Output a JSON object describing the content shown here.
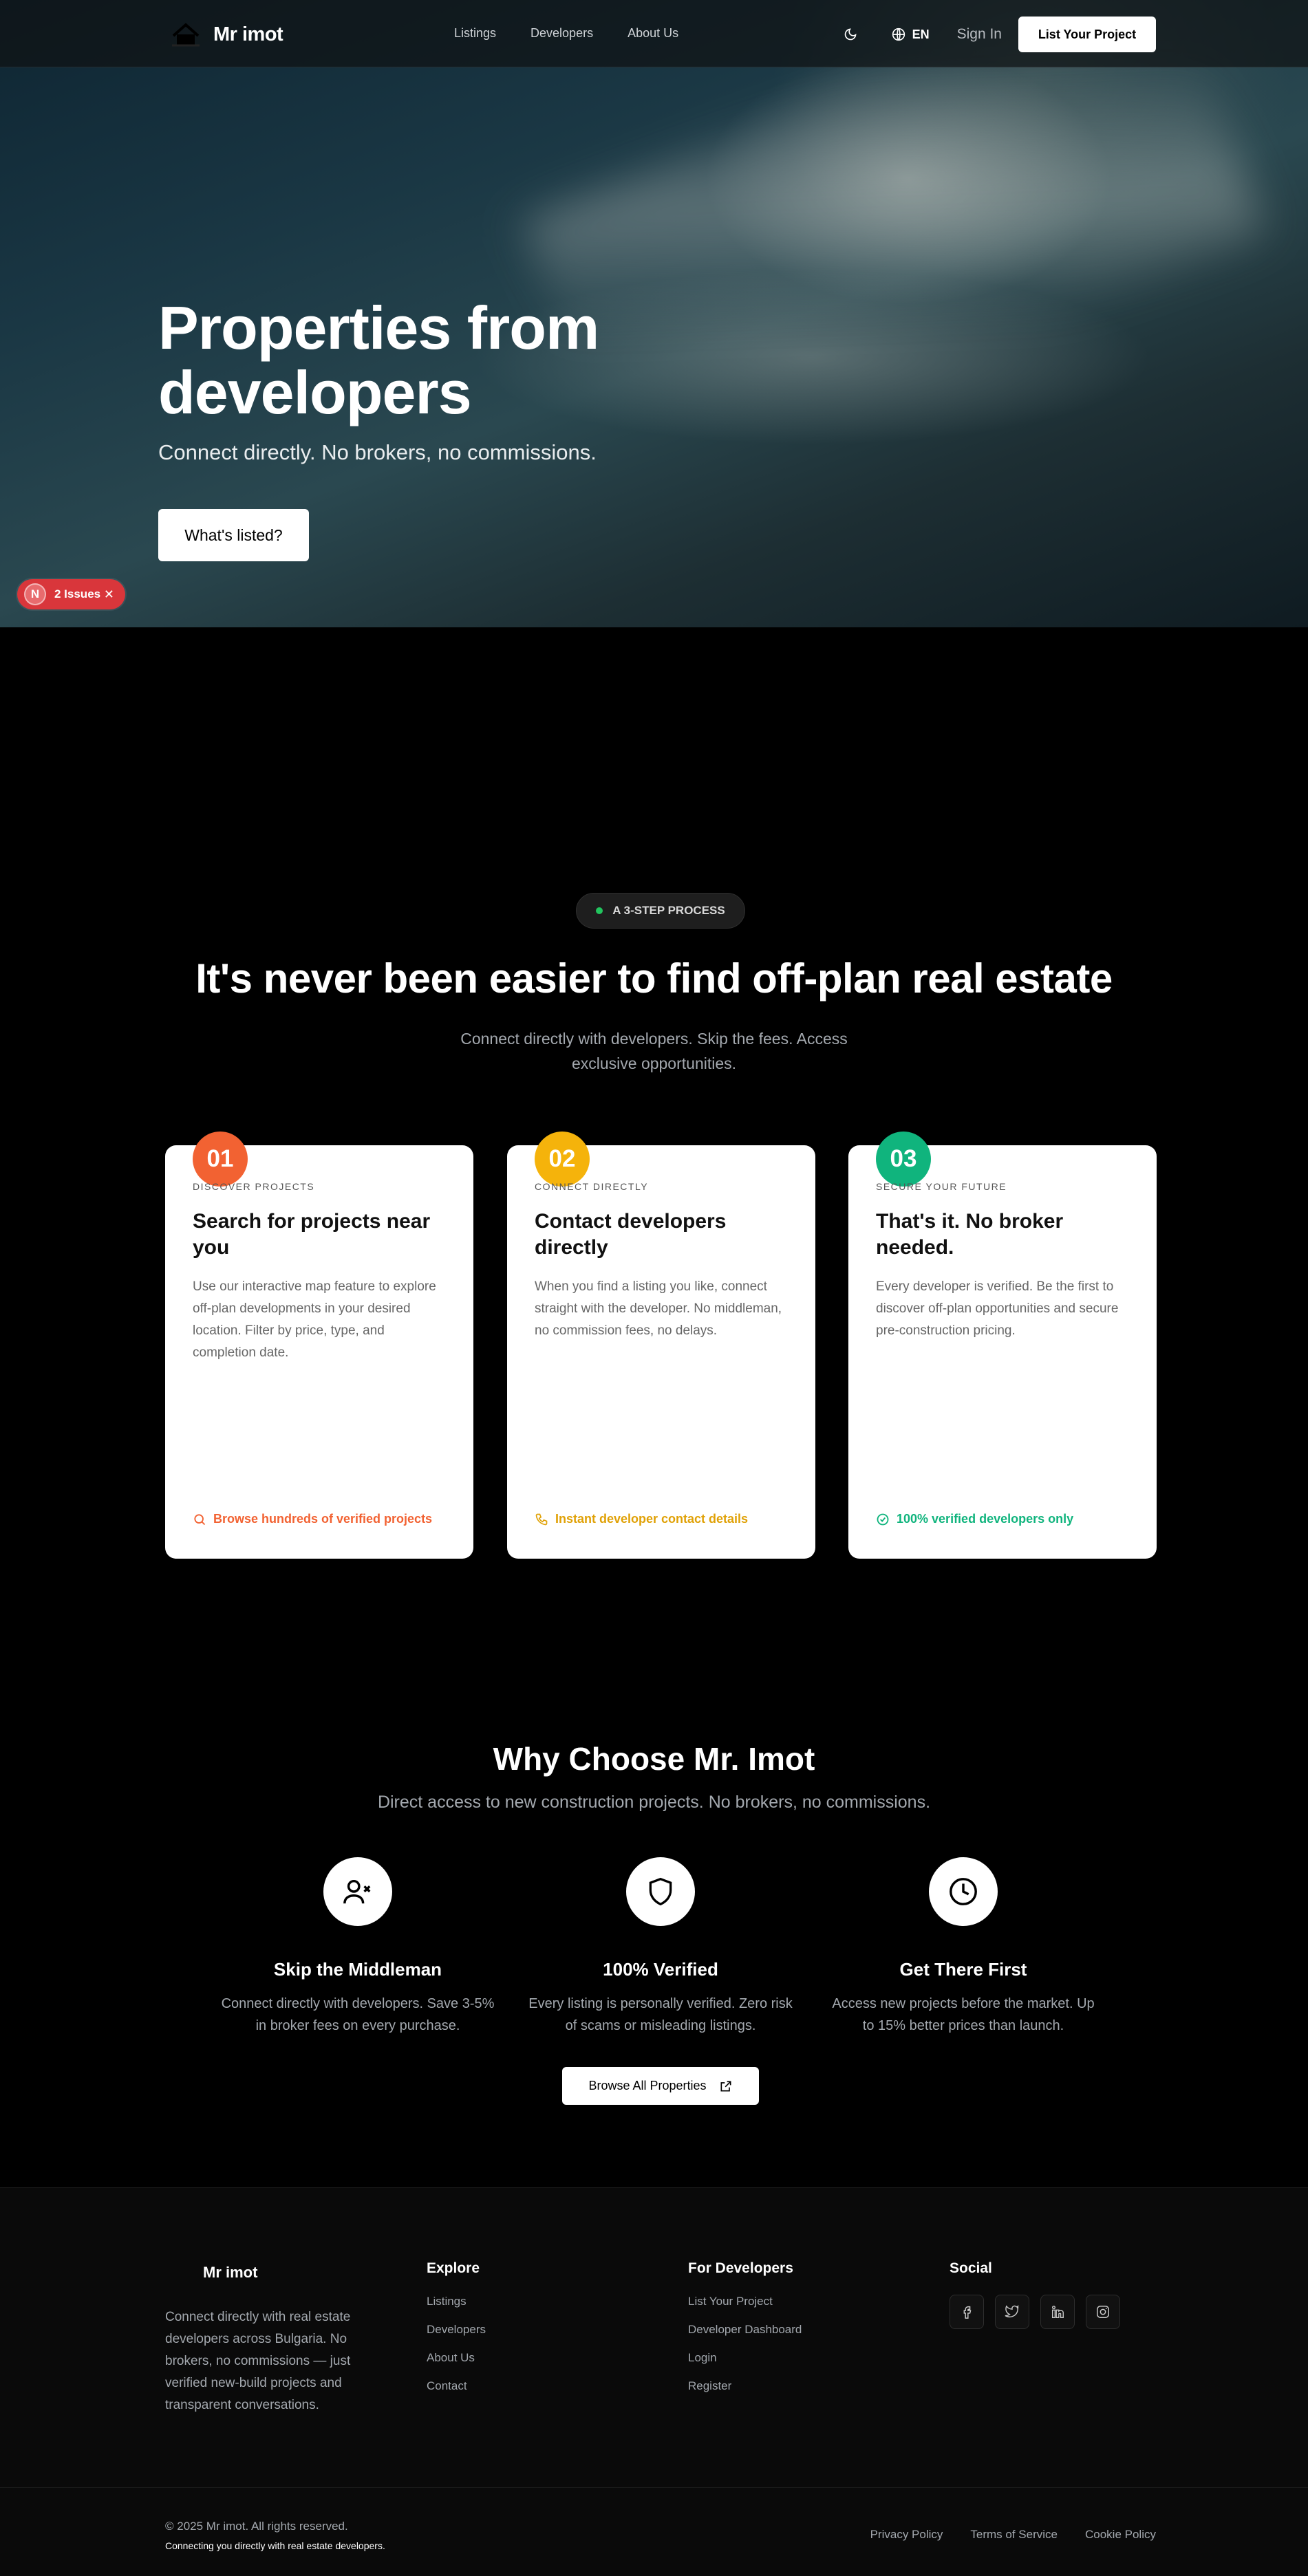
{
  "brand": {
    "name": "Mr imot"
  },
  "nav": [
    {
      "label": "Listings"
    },
    {
      "label": "Developers"
    },
    {
      "label": "About Us"
    }
  ],
  "header": {
    "language": "EN",
    "signin": "Sign In",
    "cta": "List Your Project"
  },
  "hero": {
    "title": "Properties from developers",
    "subtitle": "Connect directly. No brokers, no commissions.",
    "button": "What's listed?"
  },
  "devtools": {
    "issues": "2 Issues",
    "badge_letter": "N"
  },
  "process": {
    "pill": "A 3-STEP PROCESS",
    "title": "It's never been easier to find off-plan real estate",
    "subtitle": "Connect directly with developers. Skip the fees. Access exclusive opportunities.",
    "steps": [
      {
        "number": "01",
        "eyebrow": "DISCOVER PROJECTS",
        "title": "Search for projects near you",
        "body": "Use our interactive map feature to explore off-plan developments in your desired location. Filter by price, type, and completion date.",
        "footer": "Browse hundreds of verified projects",
        "color": "#f26232",
        "icon": "search-icon"
      },
      {
        "number": "02",
        "eyebrow": "CONNECT DIRECTLY",
        "title": "Contact developers directly",
        "body": "When you find a listing you like, connect straight with the developer. No middleman, no commission fees, no delays.",
        "footer": "Instant developer contact details",
        "color": "#f5b30b",
        "icon": "phone-icon"
      },
      {
        "number": "03",
        "eyebrow": "SECURE YOUR FUTURE",
        "title": "That's it. No broker needed.",
        "body": "Every developer is verified. Be the first to discover off-plan opportunities and secure pre-construction pricing.",
        "footer": "100% verified developers only",
        "color": "#10b47d",
        "icon": "check-circle-icon"
      }
    ]
  },
  "why": {
    "title": "Why Choose Mr. Imot",
    "subtitle": "Direct access to new construction projects. No brokers, no commissions.",
    "features": [
      {
        "title": "Skip the Middleman",
        "desc": "Connect directly with developers. Save 3-5% in broker fees on every purchase.",
        "icon": "user-x-icon"
      },
      {
        "title": "100% Verified",
        "desc": "Every listing is personally verified. Zero risk of scams or misleading listings.",
        "icon": "shield-icon"
      },
      {
        "title": "Get There First",
        "desc": "Access new projects before the market. Up to 15% better prices than launch.",
        "icon": "clock-icon"
      }
    ],
    "button": "Browse All Properties"
  },
  "footer": {
    "brand": "Mr imot",
    "about": "Connect directly with real estate developers across Bulgaria. No brokers, no commissions — just verified new-build projects and transparent conversations.",
    "explore": {
      "heading": "Explore",
      "links": [
        "Listings",
        "Developers",
        "About Us",
        "Contact"
      ]
    },
    "developers": {
      "heading": "For Developers",
      "links": [
        "List Your Project",
        "Developer Dashboard",
        "Login",
        "Register"
      ]
    },
    "social": {
      "heading": "Social",
      "items": [
        "facebook-icon",
        "twitter-icon",
        "linkedin-icon",
        "instagram-icon"
      ]
    },
    "copyright": "© 2025 Mr imot. All rights reserved.",
    "tagline": "Connecting you directly with real estate developers.",
    "legal": [
      "Privacy Policy",
      "Terms of Service",
      "Cookie Policy"
    ]
  }
}
